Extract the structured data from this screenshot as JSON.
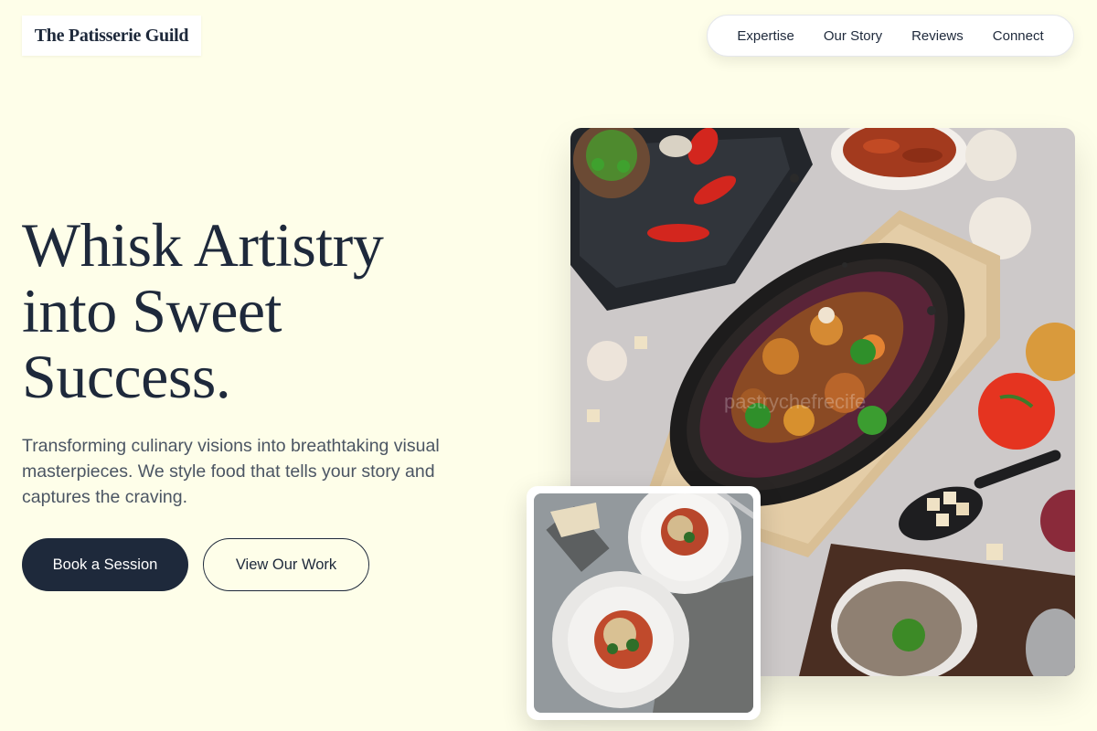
{
  "brand": {
    "name": "The Patisserie Guild"
  },
  "nav": {
    "items": [
      {
        "label": "Expertise"
      },
      {
        "label": "Our Story"
      },
      {
        "label": "Reviews"
      },
      {
        "label": "Connect"
      }
    ]
  },
  "hero": {
    "headline_lines": [
      "Whisk Artistry",
      "into Sweet",
      "Success."
    ],
    "subtitle": "Transforming culinary visions into breathtaking visual masterpieces. We style food that tells your story and captures the craving.",
    "primary_button": "Book a Session",
    "secondary_button": "View Our Work"
  },
  "images": {
    "main": {
      "icon": "food-spread-photo",
      "watermark": "pastrychefrecife"
    },
    "secondary": {
      "icon": "pasta-plates-photo"
    }
  },
  "colors": {
    "background": "#fefee9",
    "text_dark": "#1e293b",
    "text_muted": "#4b5563",
    "button_dark": "#1e293b",
    "card_white": "#ffffff"
  }
}
